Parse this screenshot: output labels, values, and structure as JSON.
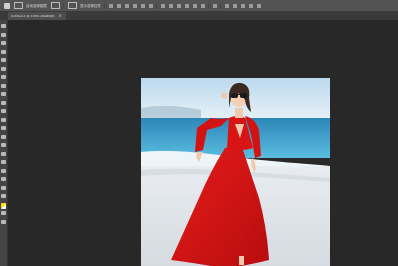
{
  "options_bar": {
    "label_1": "自动选择图层",
    "label_2": "显示变换控件",
    "icons": [
      "move-tool-icon",
      "layer-dropdown-icon",
      "align-icons",
      "distribute-icons",
      "3d-mode-icons"
    ]
  },
  "document": {
    "tab_label": "Untitled-1 @ 100% (RGB/8#)",
    "close_glyph": "×"
  },
  "tools": [
    "move-tool-icon",
    "marquee-tool-icon",
    "lasso-tool-icon",
    "quick-select-tool-icon",
    "crop-tool-icon",
    "eyedropper-tool-icon",
    "healing-brush-tool-icon",
    "brush-tool-icon",
    "clone-stamp-tool-icon",
    "history-brush-tool-icon",
    "eraser-tool-icon",
    "gradient-tool-icon",
    "blur-tool-icon",
    "dodge-tool-icon",
    "pen-tool-icon",
    "type-tool-icon",
    "path-select-tool-icon",
    "shape-tool-icon",
    "hand-tool-icon",
    "zoom-tool-icon",
    "edit-toolbar-icon",
    "color-swatches-icon",
    "quick-mask-icon",
    "screen-mode-icon"
  ],
  "colors": {
    "workspace": "#282828",
    "options_bar": "#535353",
    "toolbar": "#454545",
    "dress_red": "#d81414",
    "sky": "#cfe6f3",
    "sea": "#3fa4cf",
    "sand": "#dfe3e8"
  }
}
